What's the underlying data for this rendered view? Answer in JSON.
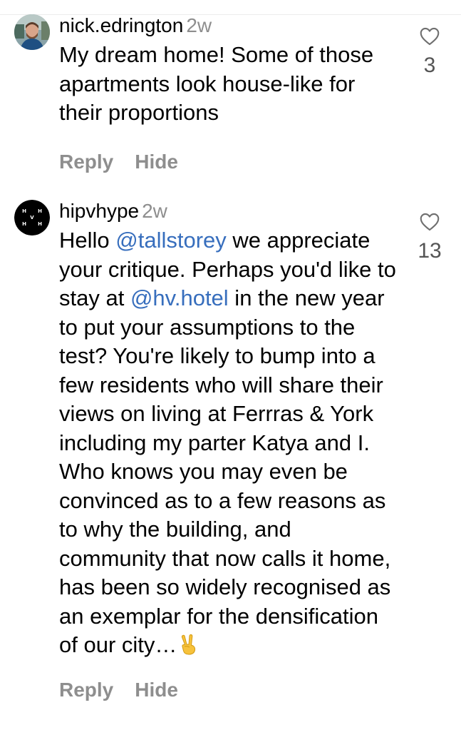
{
  "comments": [
    {
      "username": "nick.edrington",
      "time": "2w",
      "text_parts": [
        "My dream home! Some of those apartments look house-like for their proportions"
      ],
      "likes": "3",
      "reply_label": "Reply",
      "hide_label": "Hide"
    },
    {
      "username": "hipvhype",
      "time": "2w",
      "text_parts": [
        "Hello ",
        "@tallstorey",
        " we appreciate your critique. Perhaps you'd like to stay at ",
        "@hv.hotel",
        " in the new year to put your assumptions to the test? You're likely to bump into a few residents who will share their views on living at Ferrras & York including my parter Katya and I. Who knows you may even be convinced as to a few reasons as to why the building, and community that now calls it home, has been so widely recognised as an exemplar for the densification of our city…"
      ],
      "emoji": "victory-hand-emoji",
      "likes": "13",
      "reply_label": "Reply",
      "hide_label": "Hide"
    }
  ],
  "colors": {
    "mention": "#376ebd",
    "muted": "#8e8e8e"
  }
}
